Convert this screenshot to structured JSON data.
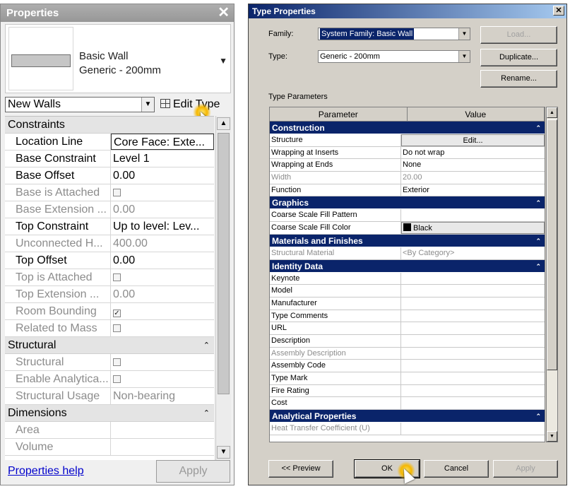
{
  "properties": {
    "title": "Properties",
    "type_family": "Basic Wall",
    "type_name": "Generic - 200mm",
    "filter_value": "New Walls",
    "edit_type_label": "Edit Type",
    "groups": [
      {
        "name": "Constraints",
        "rows": [
          {
            "name": "Location Line",
            "value": "Core Face: Exte...",
            "enabled": true,
            "selected": true
          },
          {
            "name": "Base Constraint",
            "value": "Level 1",
            "enabled": true
          },
          {
            "name": "Base Offset",
            "value": "0.00",
            "enabled": true
          },
          {
            "name": "Base is Attached",
            "checkbox": true,
            "checked": false,
            "enabled": false
          },
          {
            "name": "Base Extension ...",
            "value": "0.00",
            "enabled": false
          },
          {
            "name": "Top Constraint",
            "value": "Up to level: Lev...",
            "enabled": true
          },
          {
            "name": "Unconnected H...",
            "value": "400.00",
            "enabled": false
          },
          {
            "name": "Top Offset",
            "value": "0.00",
            "enabled": true
          },
          {
            "name": "Top is Attached",
            "checkbox": true,
            "checked": false,
            "enabled": false
          },
          {
            "name": "Top Extension ...",
            "value": "0.00",
            "enabled": false
          },
          {
            "name": "Room Bounding",
            "checkbox": true,
            "checked": true,
            "enabled": false
          },
          {
            "name": "Related to Mass",
            "checkbox": true,
            "checked": false,
            "enabled": false
          }
        ]
      },
      {
        "name": "Structural",
        "rows": [
          {
            "name": "Structural",
            "checkbox": true,
            "checked": false,
            "enabled": false
          },
          {
            "name": "Enable Analytica...",
            "checkbox": true,
            "checked": false,
            "enabled": false
          },
          {
            "name": "Structural Usage",
            "value": "Non-bearing",
            "enabled": false
          }
        ]
      },
      {
        "name": "Dimensions",
        "rows": [
          {
            "name": "Area",
            "value": "",
            "enabled": false
          },
          {
            "name": "Volume",
            "value": "",
            "enabled": false
          }
        ]
      }
    ],
    "help_link": "Properties help",
    "apply_label": "Apply"
  },
  "type_properties": {
    "title": "Type Properties",
    "family_label": "Family:",
    "family_value": "System Family: Basic Wall",
    "type_label": "Type:",
    "type_value": "Generic - 200mm",
    "load_label": "Load...",
    "duplicate_label": "Duplicate...",
    "rename_label": "Rename...",
    "section_label": "Type Parameters",
    "column_headers": [
      "Parameter",
      "Value"
    ],
    "groups": [
      {
        "name": "Construction",
        "rows": [
          {
            "name": "Structure",
            "value": "Edit...",
            "button": true
          },
          {
            "name": "Wrapping at Inserts",
            "value": "Do not wrap"
          },
          {
            "name": "Wrapping at Ends",
            "value": "None"
          },
          {
            "name": "Width",
            "value": "20.00",
            "enabled": false
          },
          {
            "name": "Function",
            "value": "Exterior"
          }
        ]
      },
      {
        "name": "Graphics",
        "rows": [
          {
            "name": "Coarse Scale Fill Pattern",
            "value": ""
          },
          {
            "name": "Coarse Scale Fill Color",
            "value": "Black",
            "button": true,
            "swatch": "#000000"
          }
        ]
      },
      {
        "name": "Materials and Finishes",
        "rows": [
          {
            "name": "Structural Material",
            "value": "<By Category>",
            "enabled": false
          }
        ]
      },
      {
        "name": "Identity Data",
        "rows": [
          {
            "name": "Keynote",
            "value": ""
          },
          {
            "name": "Model",
            "value": ""
          },
          {
            "name": "Manufacturer",
            "value": ""
          },
          {
            "name": "Type Comments",
            "value": ""
          },
          {
            "name": "URL",
            "value": ""
          },
          {
            "name": "Description",
            "value": ""
          },
          {
            "name": "Assembly Description",
            "value": "",
            "enabled": false
          },
          {
            "name": "Assembly Code",
            "value": ""
          },
          {
            "name": "Type Mark",
            "value": ""
          },
          {
            "name": "Fire Rating",
            "value": ""
          },
          {
            "name": "Cost",
            "value": ""
          }
        ]
      },
      {
        "name": "Analytical Properties",
        "rows": [
          {
            "name": "Heat Transfer Coefficient (U)",
            "value": "",
            "enabled": false
          }
        ]
      }
    ],
    "preview_label": "<< Preview",
    "ok_label": "OK",
    "cancel_label": "Cancel",
    "apply_label": "Apply"
  }
}
